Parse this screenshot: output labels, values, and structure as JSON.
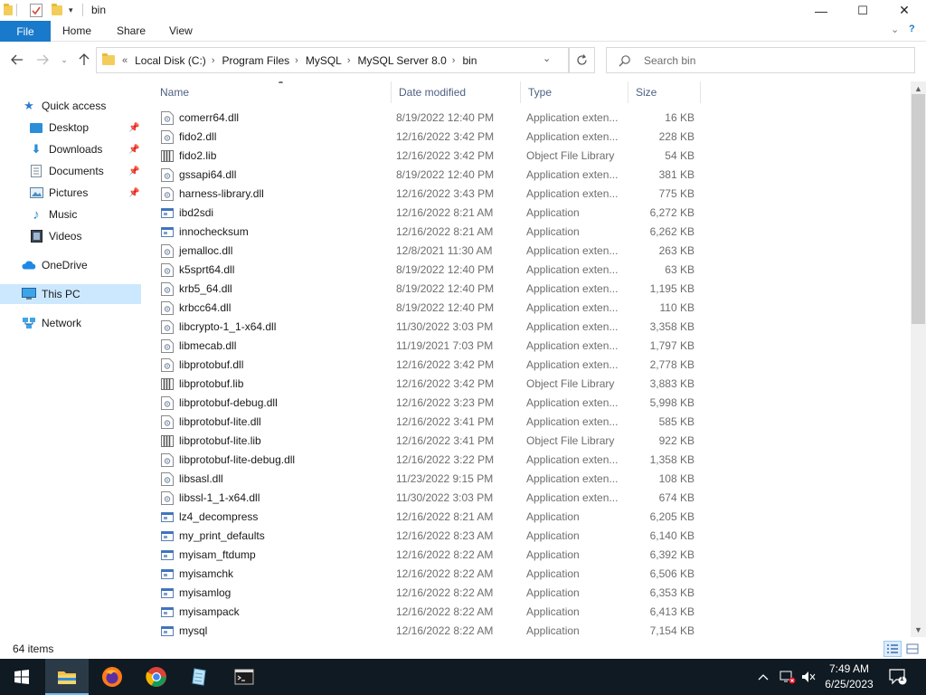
{
  "window": {
    "title": "bin",
    "controls": {
      "minimize": "—",
      "maximize": "☐",
      "close": "✕"
    }
  },
  "ribbon": {
    "tabs": [
      "File",
      "Home",
      "Share",
      "View"
    ]
  },
  "address": {
    "overflow": "«",
    "crumbs": [
      "Local Disk (C:)",
      "Program Files",
      "MySQL",
      "MySQL Server 8.0",
      "bin"
    ],
    "separator": "›"
  },
  "search": {
    "placeholder": "Search bin"
  },
  "nav": {
    "quick_access": "Quick access",
    "items": [
      {
        "label": "Desktop",
        "icon": "desktop-icon",
        "pinned": true
      },
      {
        "label": "Downloads",
        "icon": "downloads-icon",
        "pinned": true
      },
      {
        "label": "Documents",
        "icon": "documents-icon",
        "pinned": true
      },
      {
        "label": "Pictures",
        "icon": "pictures-icon",
        "pinned": true
      },
      {
        "label": "Music",
        "icon": "music-icon",
        "pinned": false
      },
      {
        "label": "Videos",
        "icon": "videos-icon",
        "pinned": false
      }
    ],
    "onedrive": "OneDrive",
    "this_pc": "This PC",
    "network": "Network"
  },
  "columns": {
    "name": "Name",
    "date": "Date modified",
    "type": "Type",
    "size": "Size"
  },
  "files": [
    {
      "name": "comerr64.dll",
      "date": "8/19/2022 12:40 PM",
      "type": "Application exten...",
      "size": "16 KB",
      "kind": "dll"
    },
    {
      "name": "fido2.dll",
      "date": "12/16/2022 3:42 PM",
      "type": "Application exten...",
      "size": "228 KB",
      "kind": "dll"
    },
    {
      "name": "fido2.lib",
      "date": "12/16/2022 3:42 PM",
      "type": "Object File Library",
      "size": "54 KB",
      "kind": "lib"
    },
    {
      "name": "gssapi64.dll",
      "date": "8/19/2022 12:40 PM",
      "type": "Application exten...",
      "size": "381 KB",
      "kind": "dll"
    },
    {
      "name": "harness-library.dll",
      "date": "12/16/2022 3:43 PM",
      "type": "Application exten...",
      "size": "775 KB",
      "kind": "dll"
    },
    {
      "name": "ibd2sdi",
      "date": "12/16/2022 8:21 AM",
      "type": "Application",
      "size": "6,272 KB",
      "kind": "exe"
    },
    {
      "name": "innochecksum",
      "date": "12/16/2022 8:21 AM",
      "type": "Application",
      "size": "6,262 KB",
      "kind": "exe"
    },
    {
      "name": "jemalloc.dll",
      "date": "12/8/2021 11:30 AM",
      "type": "Application exten...",
      "size": "263 KB",
      "kind": "dll"
    },
    {
      "name": "k5sprt64.dll",
      "date": "8/19/2022 12:40 PM",
      "type": "Application exten...",
      "size": "63 KB",
      "kind": "dll"
    },
    {
      "name": "krb5_64.dll",
      "date": "8/19/2022 12:40 PM",
      "type": "Application exten...",
      "size": "1,195 KB",
      "kind": "dll"
    },
    {
      "name": "krbcc64.dll",
      "date": "8/19/2022 12:40 PM",
      "type": "Application exten...",
      "size": "110 KB",
      "kind": "dll"
    },
    {
      "name": "libcrypto-1_1-x64.dll",
      "date": "11/30/2022 3:03 PM",
      "type": "Application exten...",
      "size": "3,358 KB",
      "kind": "dll"
    },
    {
      "name": "libmecab.dll",
      "date": "11/19/2021 7:03 PM",
      "type": "Application exten...",
      "size": "1,797 KB",
      "kind": "dll"
    },
    {
      "name": "libprotobuf.dll",
      "date": "12/16/2022 3:42 PM",
      "type": "Application exten...",
      "size": "2,778 KB",
      "kind": "dll"
    },
    {
      "name": "libprotobuf.lib",
      "date": "12/16/2022 3:42 PM",
      "type": "Object File Library",
      "size": "3,883 KB",
      "kind": "lib"
    },
    {
      "name": "libprotobuf-debug.dll",
      "date": "12/16/2022 3:23 PM",
      "type": "Application exten...",
      "size": "5,998 KB",
      "kind": "dll"
    },
    {
      "name": "libprotobuf-lite.dll",
      "date": "12/16/2022 3:41 PM",
      "type": "Application exten...",
      "size": "585 KB",
      "kind": "dll"
    },
    {
      "name": "libprotobuf-lite.lib",
      "date": "12/16/2022 3:41 PM",
      "type": "Object File Library",
      "size": "922 KB",
      "kind": "lib"
    },
    {
      "name": "libprotobuf-lite-debug.dll",
      "date": "12/16/2022 3:22 PM",
      "type": "Application exten...",
      "size": "1,358 KB",
      "kind": "dll"
    },
    {
      "name": "libsasl.dll",
      "date": "11/23/2022 9:15 PM",
      "type": "Application exten...",
      "size": "108 KB",
      "kind": "dll"
    },
    {
      "name": "libssl-1_1-x64.dll",
      "date": "11/30/2022 3:03 PM",
      "type": "Application exten...",
      "size": "674 KB",
      "kind": "dll"
    },
    {
      "name": "lz4_decompress",
      "date": "12/16/2022 8:21 AM",
      "type": "Application",
      "size": "6,205 KB",
      "kind": "exe"
    },
    {
      "name": "my_print_defaults",
      "date": "12/16/2022 8:23 AM",
      "type": "Application",
      "size": "6,140 KB",
      "kind": "exe"
    },
    {
      "name": "myisam_ftdump",
      "date": "12/16/2022 8:22 AM",
      "type": "Application",
      "size": "6,392 KB",
      "kind": "exe"
    },
    {
      "name": "myisamchk",
      "date": "12/16/2022 8:22 AM",
      "type": "Application",
      "size": "6,506 KB",
      "kind": "exe"
    },
    {
      "name": "myisamlog",
      "date": "12/16/2022 8:22 AM",
      "type": "Application",
      "size": "6,353 KB",
      "kind": "exe"
    },
    {
      "name": "myisampack",
      "date": "12/16/2022 8:22 AM",
      "type": "Application",
      "size": "6,413 KB",
      "kind": "exe"
    },
    {
      "name": "mysql",
      "date": "12/16/2022 8:22 AM",
      "type": "Application",
      "size": "7,154 KB",
      "kind": "exe"
    }
  ],
  "status": {
    "item_count": "64 items"
  },
  "taskbar": {
    "apps": [
      "start-icon",
      "file-explorer-icon",
      "firefox-icon",
      "chrome-icon",
      "notepad-icon",
      "terminal-icon"
    ],
    "time": "7:49 AM",
    "date": "6/25/2023",
    "notification_count": "1"
  },
  "colors": {
    "file_tab": "#1979ca",
    "selection": "#cce8ff",
    "header_text": "#4d6082",
    "taskbar": "#101a22"
  }
}
